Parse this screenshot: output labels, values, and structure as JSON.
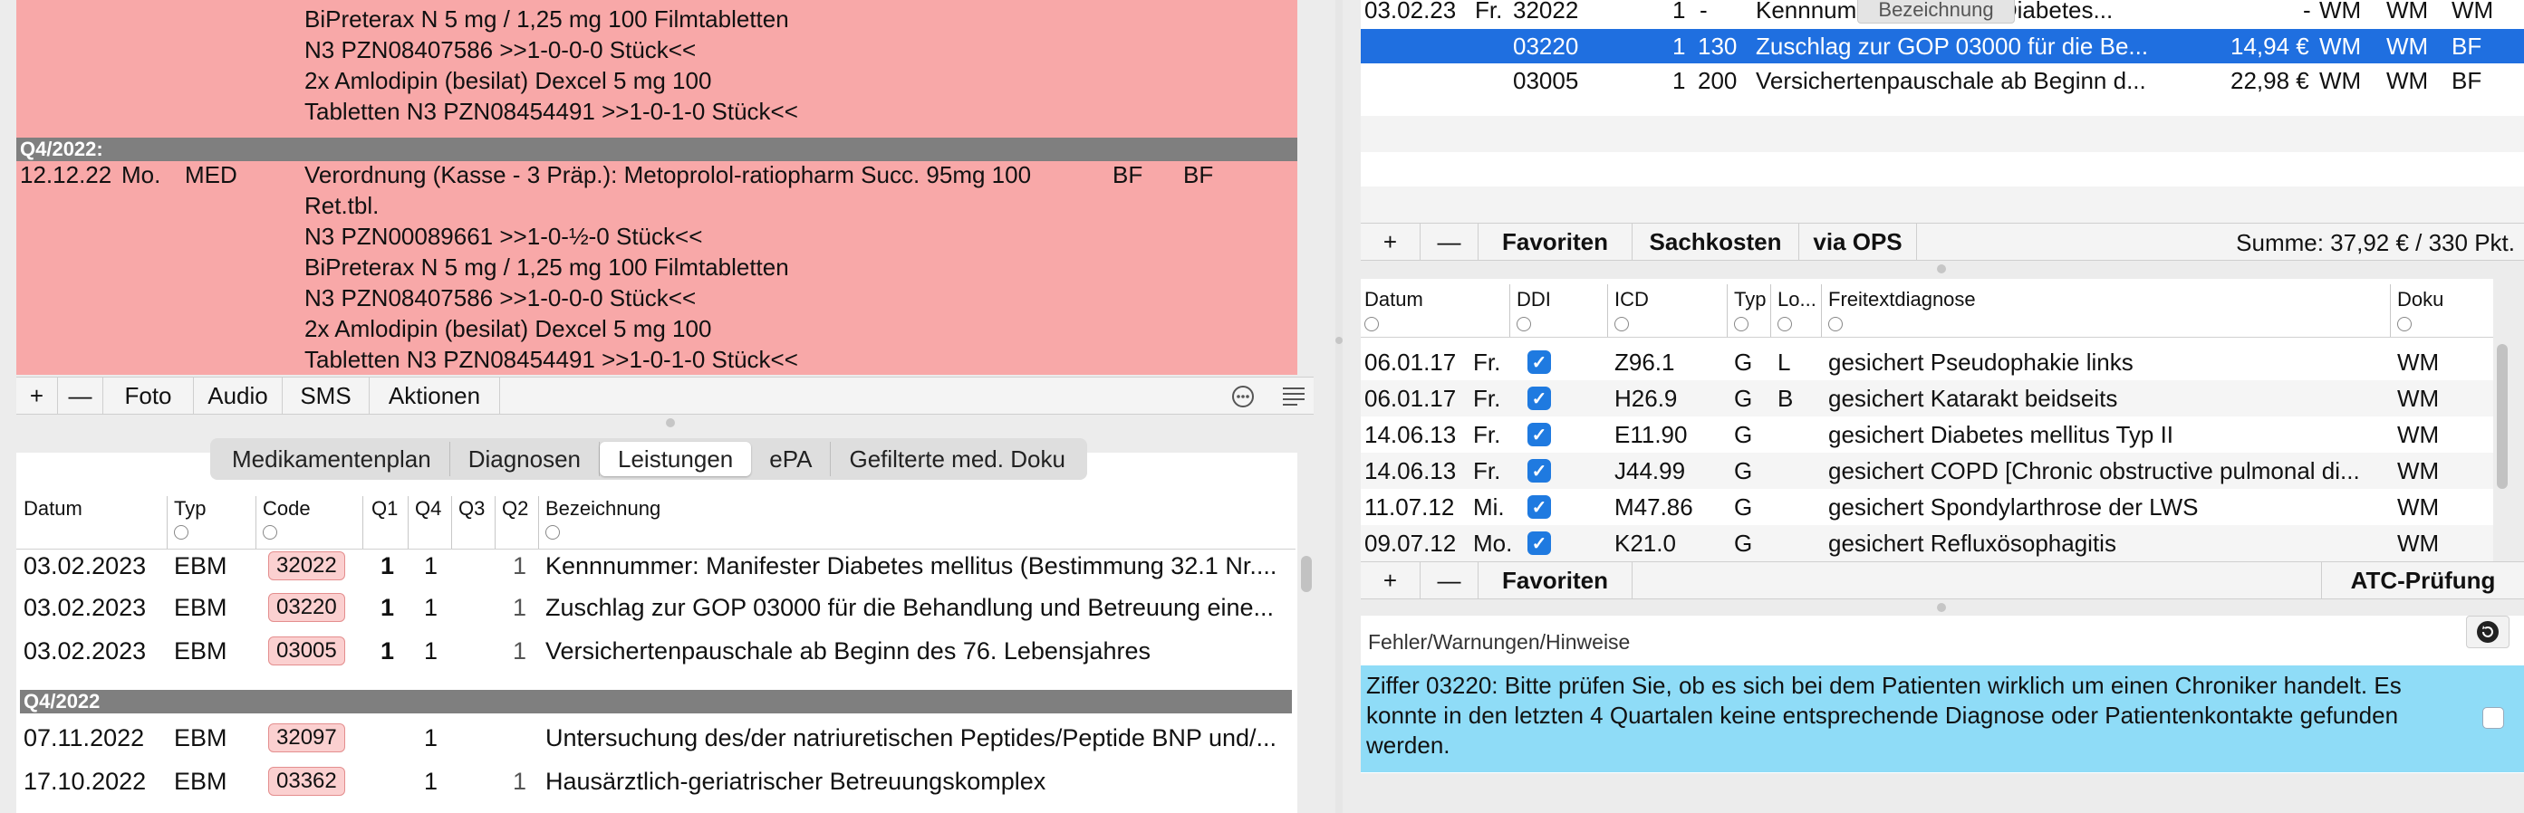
{
  "journal": {
    "lines_top": [
      "BiPreterax N 5 mg / 1,25 mg 100 Filmtabletten",
      "N3 PZN08407586 >>1-0-0-0 Stück<<",
      "2x Amlodipin (besilat) Dexcel 5 mg 100",
      "Tabletten N3 PZN08454491 >>1-0-1-0 Stück<<"
    ],
    "quarter_label": "Q4/2022:",
    "entry": {
      "date": "12.12.22",
      "weekday": "Mo.",
      "type": "MED",
      "lines": [
        "Verordnung (Kasse - 3 Präp.): Metoprolol-ratiopharm Succ. 95mg 100",
        "Ret.tbl.",
        "N3 PZN00089661 >>1-0-½-0 Stück<<",
        "BiPreterax N 5 mg / 1,25 mg 100 Filmtabletten",
        "N3 PZN08407586 >>1-0-0-0 Stück<<",
        "2x Amlodipin (besilat) Dexcel 5 mg 100",
        "Tabletten N3 PZN08454491 >>1-0-1-0 Stück<<"
      ],
      "col1": "BF",
      "col2": "BF"
    }
  },
  "journal_toolbar": {
    "add": "+",
    "remove": "—",
    "foto": "Foto",
    "audio": "Audio",
    "sms": "SMS",
    "aktionen": "Aktionen"
  },
  "tabs": [
    "Medikamentenplan",
    "Diagnosen",
    "Leistungen",
    "ePA",
    "Gefilterte med. Doku"
  ],
  "active_tab": "Leistungen",
  "leistungen": {
    "headers": {
      "datum": "Datum",
      "typ": "Typ",
      "code": "Code",
      "q1": "Q1",
      "q4": "Q4",
      "q3": "Q3",
      "q2": "Q2",
      "bezeichnung": "Bezeichnung"
    },
    "rows": [
      {
        "datum": "03.02.2023",
        "typ": "EBM",
        "code": "32022",
        "q1": "1",
        "q4": "1",
        "q2": "1",
        "bez": "Kennnummer: Manifester Diabetes mellitus (Bestimmung 32.1 Nr...."
      },
      {
        "datum": "03.02.2023",
        "typ": "EBM",
        "code": "03220",
        "q1": "1",
        "q4": "1",
        "q2": "1",
        "bez": "Zuschlag zur GOP 03000 für die Behandlung und Betreuung eine..."
      },
      {
        "datum": "03.02.2023",
        "typ": "EBM",
        "code": "03005",
        "q1": "1",
        "q4": "1",
        "q2": "1",
        "bez": "Versichertenpauschale ab Beginn des 76. Lebensjahres"
      }
    ],
    "quarter_label": "Q4/2022",
    "rows_q4": [
      {
        "datum": "07.11.2022",
        "typ": "EBM",
        "code": "32097",
        "q1": "",
        "q4": "1",
        "q2": "",
        "bez": "Untersuchung des/der natriuretischen Peptides/Peptide BNP und/..."
      },
      {
        "datum": "17.10.2022",
        "typ": "EBM",
        "code": "03362",
        "q1": "",
        "q4": "1",
        "q2": "1",
        "bez": "Hausärztlich-geriatrischer Betreuungskomplex"
      }
    ]
  },
  "billing": {
    "tooltip": "Bezeichnung",
    "rows": [
      {
        "date": "03.02.23",
        "wd": "Fr.",
        "code": "32022",
        "n": "1",
        "pts": "-",
        "bez": "Kennnumm",
        "bez_tail": "r Diabetes...",
        "amount": "-",
        "c1": "WM",
        "c2": "WM",
        "c3": "WM",
        "selected": false
      },
      {
        "date": "",
        "wd": "",
        "code": "03220",
        "n": "1",
        "pts": "130",
        "bez": "Zuschlag zur GOP 03000 für die Be...",
        "bez_tail": "",
        "amount": "14,94 €",
        "c1": "WM",
        "c2": "WM",
        "c3": "BF",
        "selected": true
      },
      {
        "date": "",
        "wd": "",
        "code": "03005",
        "n": "1",
        "pts": "200",
        "bez": "Versichertenpauschale ab Beginn d...",
        "bez_tail": "",
        "amount": "22,98 €",
        "c1": "WM",
        "c2": "WM",
        "c3": "BF",
        "selected": false
      }
    ],
    "toolbar": {
      "add": "+",
      "remove": "—",
      "favoriten": "Favoriten",
      "sachkosten": "Sachkosten",
      "via_ops": "via OPS"
    },
    "summe": "Summe: 37,92 € / 330 Pkt."
  },
  "diagnosen": {
    "headers": {
      "datum": "Datum",
      "ddi": "DDI",
      "icd": "ICD",
      "typ": "Typ",
      "lo": "Lo...",
      "freitext": "Freitextdiagnose",
      "doku": "Doku"
    },
    "rows": [
      {
        "datum": "06.01.17",
        "wd": "Fr.",
        "icd": "Z96.1",
        "typ": "G",
        "lo": "L",
        "text": "gesichert Pseudophakie links",
        "doku": "WM"
      },
      {
        "datum": "06.01.17",
        "wd": "Fr.",
        "icd": "H26.9",
        "typ": "G",
        "lo": "B",
        "text": "gesichert Katarakt beidseits",
        "doku": "WM"
      },
      {
        "datum": "14.06.13",
        "wd": "Fr.",
        "icd": "E11.90",
        "typ": "G",
        "lo": "",
        "text": "gesichert Diabetes mellitus Typ II",
        "doku": "WM"
      },
      {
        "datum": "14.06.13",
        "wd": "Fr.",
        "icd": "J44.99",
        "typ": "G",
        "lo": "",
        "text": "gesichert COPD [Chronic obstructive pulmonal di...",
        "doku": "WM"
      },
      {
        "datum": "11.07.12",
        "wd": "Mi.",
        "icd": "M47.86",
        "typ": "G",
        "lo": "",
        "text": "gesichert Spondylarthrose der LWS",
        "doku": "WM"
      },
      {
        "datum": "09.07.12",
        "wd": "Mo.",
        "icd": "K21.0",
        "typ": "G",
        "lo": "",
        "text": "gesichert Refluxösophagitis",
        "doku": "WM"
      }
    ],
    "toolbar": {
      "add": "+",
      "remove": "—",
      "favoriten": "Favoriten",
      "atc": "ATC-Prüfung"
    }
  },
  "warnings": {
    "title": "Fehler/Warnungen/Hinweise",
    "message": "Ziffer 03220: Bitte prüfen Sie, ob es sich bei dem Patienten wirklich um einen Chroniker handelt. Es konnte in den letzten 4 Quartalen keine entsprechende Diagnose oder Patientenkontakte gefunden werden."
  },
  "colors": {
    "journal_bg": "#f8a8a8",
    "selected_row": "#1f6fe0",
    "warning_bg": "#8fdcf7",
    "checkbox": "#1f7ae0"
  }
}
